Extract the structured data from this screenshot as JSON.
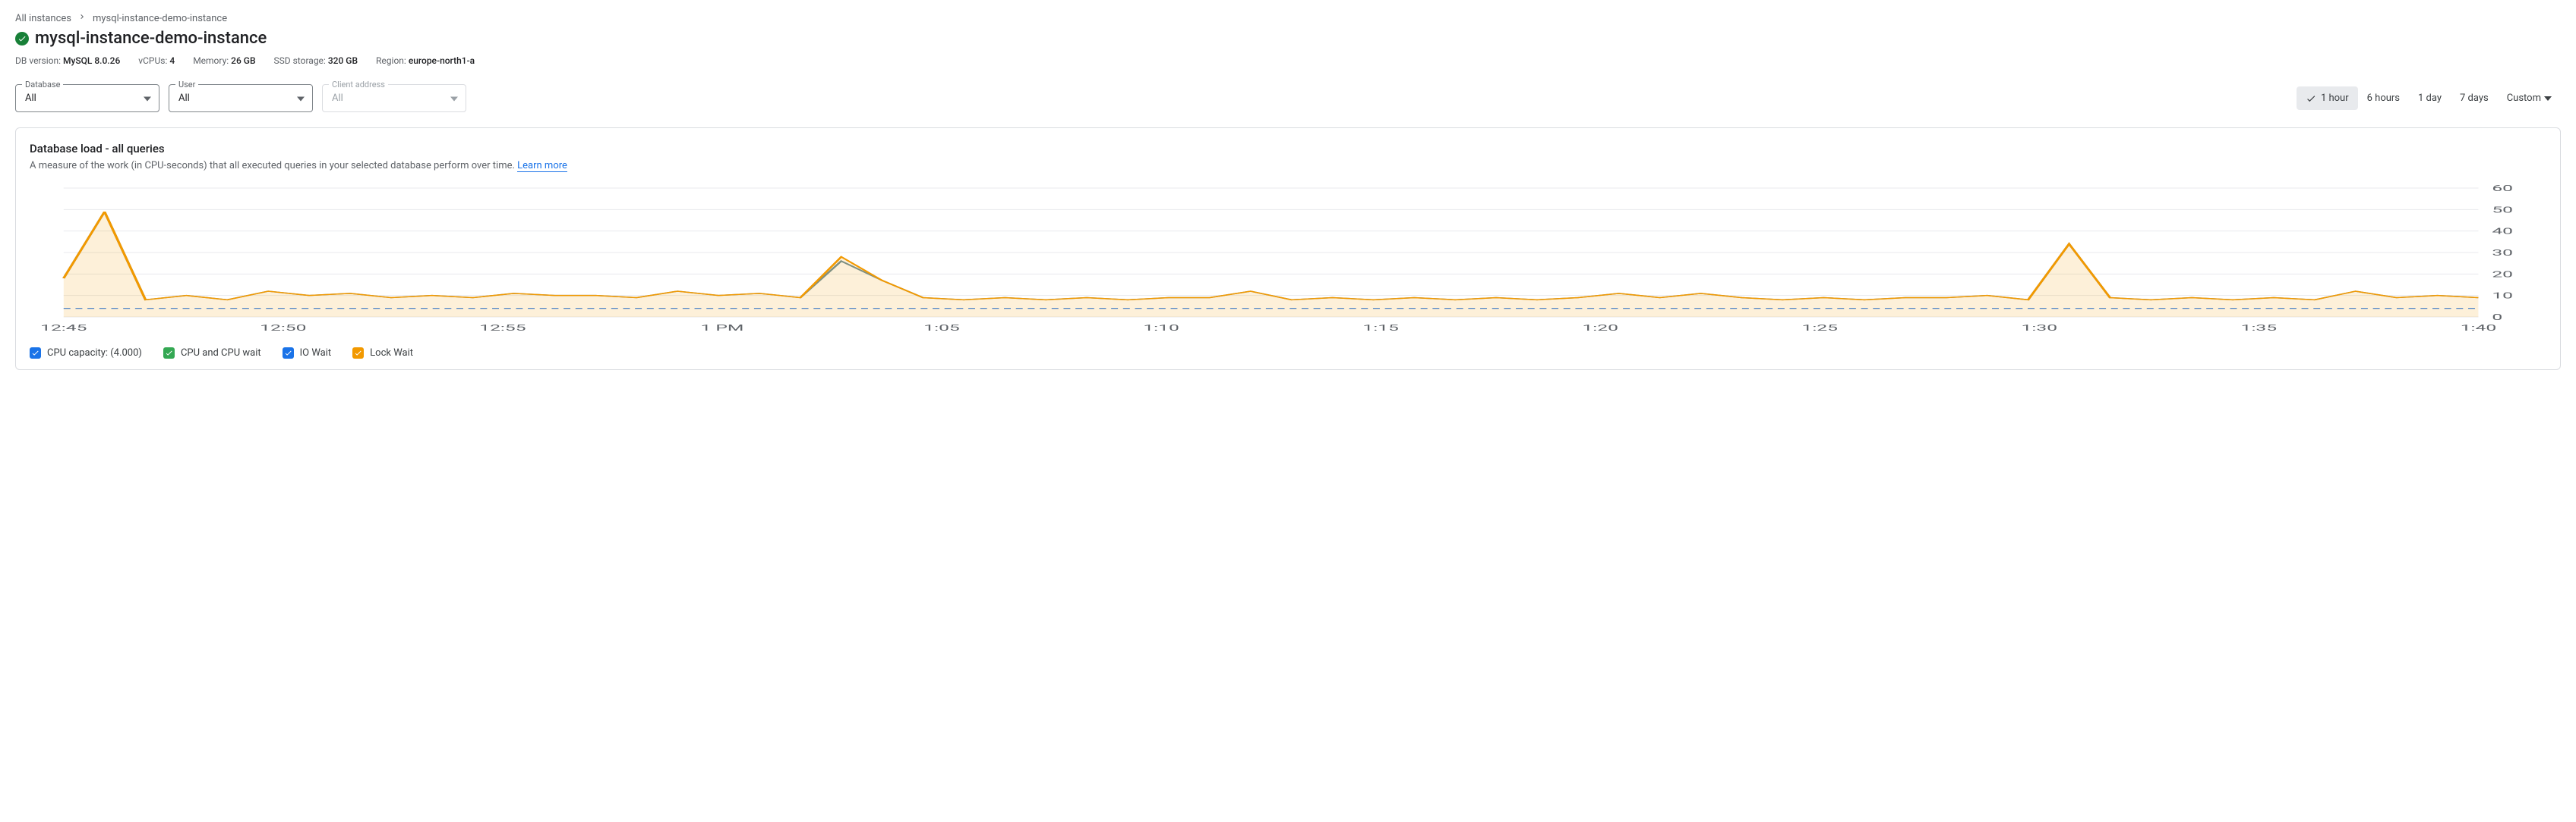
{
  "breadcrumb": {
    "root": "All instances",
    "current": "mysql-instance-demo-instance"
  },
  "title": "mysql-instance-demo-instance",
  "meta": {
    "db_version_label": "DB version:",
    "db_version": "MySQL 8.0.26",
    "vcpus_label": "vCPUs:",
    "vcpus": "4",
    "memory_label": "Memory:",
    "memory": "26 GB",
    "storage_label": "SSD storage:",
    "storage": "320 GB",
    "region_label": "Region:",
    "region": "europe-north1-a"
  },
  "filters": {
    "database_label": "Database",
    "database_value": "All",
    "user_label": "User",
    "user_value": "All",
    "client_label": "Client address",
    "client_value": "All"
  },
  "time_range": {
    "items": [
      "1 hour",
      "6 hours",
      "1 day",
      "7 days"
    ],
    "custom": "Custom",
    "active_index": 0
  },
  "card": {
    "title": "Database load - all queries",
    "subtitle": "A measure of the work (in CPU-seconds) that all executed queries in your selected database perform over time.",
    "learn_more": "Learn more"
  },
  "legend": [
    {
      "label": "CPU capacity: (4.000)",
      "color": "#1a73e8"
    },
    {
      "label": "CPU and CPU wait",
      "color": "#34a853"
    },
    {
      "label": "IO Wait",
      "color": "#1a73e8"
    },
    {
      "label": "Lock Wait",
      "color": "#f29900"
    }
  ],
  "chart_data": {
    "type": "area",
    "ylabel": "",
    "xlabel": "",
    "ylim": [
      0,
      60
    ],
    "y_ticks": [
      0,
      10,
      20,
      30,
      40,
      50,
      60
    ],
    "x_ticks": [
      "12:45",
      "12:50",
      "12:55",
      "1 PM",
      "1:05",
      "1:10",
      "1:15",
      "1:20",
      "1:25",
      "1:30",
      "1:35",
      "1:40"
    ],
    "cpu_capacity": 4.0,
    "series": [
      {
        "name": "Lock Wait",
        "color": "#f29900",
        "fill_opacity": 0.15,
        "values": [
          18,
          49,
          8,
          10,
          8,
          12,
          10,
          11,
          9,
          10,
          9,
          11,
          10,
          10,
          9,
          12,
          10,
          11,
          9,
          28,
          17,
          9,
          8,
          9,
          8,
          9,
          8,
          9,
          9,
          12,
          8,
          9,
          8,
          9,
          8,
          9,
          8,
          9,
          11,
          9,
          11,
          9,
          8,
          9,
          8,
          9,
          9,
          10,
          8,
          34,
          9,
          8,
          9,
          8,
          9,
          8,
          12,
          9,
          10,
          9
        ]
      },
      {
        "name": "CPU and CPU wait",
        "color": "#6b8f99",
        "fill_opacity": 0,
        "values": [
          18,
          49,
          8,
          10,
          8,
          12,
          10,
          11,
          9,
          10,
          9,
          11,
          10,
          10,
          9,
          12,
          10,
          11,
          9,
          26,
          17,
          9,
          8,
          9,
          8,
          9,
          8,
          9,
          9,
          12,
          8,
          9,
          8,
          9,
          8,
          9,
          8,
          9,
          11,
          9,
          11,
          9,
          8,
          9,
          8,
          9,
          9,
          10,
          8,
          34,
          9,
          8,
          9,
          8,
          9,
          8,
          12,
          9,
          10,
          9
        ]
      }
    ]
  }
}
